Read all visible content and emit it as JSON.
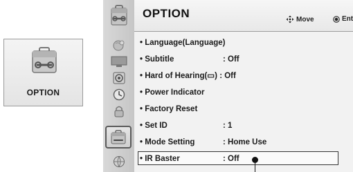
{
  "tile": {
    "label": "OPTION",
    "icon": "option-toolbox-icon"
  },
  "menu": {
    "title": "OPTION",
    "hints": [
      {
        "icon": "navigate-arrows-icon",
        "label": "Move"
      },
      {
        "icon": "enter-button-icon",
        "label": "Enter"
      }
    ],
    "category_icons": [
      "picture-icon",
      "screen-icon",
      "audio-icon",
      "clock-icon",
      "lock-icon",
      "option-icon",
      "network-icon"
    ],
    "selected_category": "option-icon",
    "items": [
      {
        "label": "• Language(Language)",
        "value": ""
      },
      {
        "label": "• Subtitle",
        "value": ": Off"
      },
      {
        "label": "• Hard of Hearing(▭) : Off",
        "value": ""
      },
      {
        "label": "• Power Indicator",
        "value": ""
      },
      {
        "label": "• Factory Reset",
        "value": ""
      },
      {
        "label": "• Set ID",
        "value": ": 1"
      },
      {
        "label": "• Mode Setting",
        "value": ": Home Use"
      },
      {
        "label": "• IR Baster",
        "value": ": Off"
      }
    ],
    "focused_item": "• IR Baster"
  }
}
